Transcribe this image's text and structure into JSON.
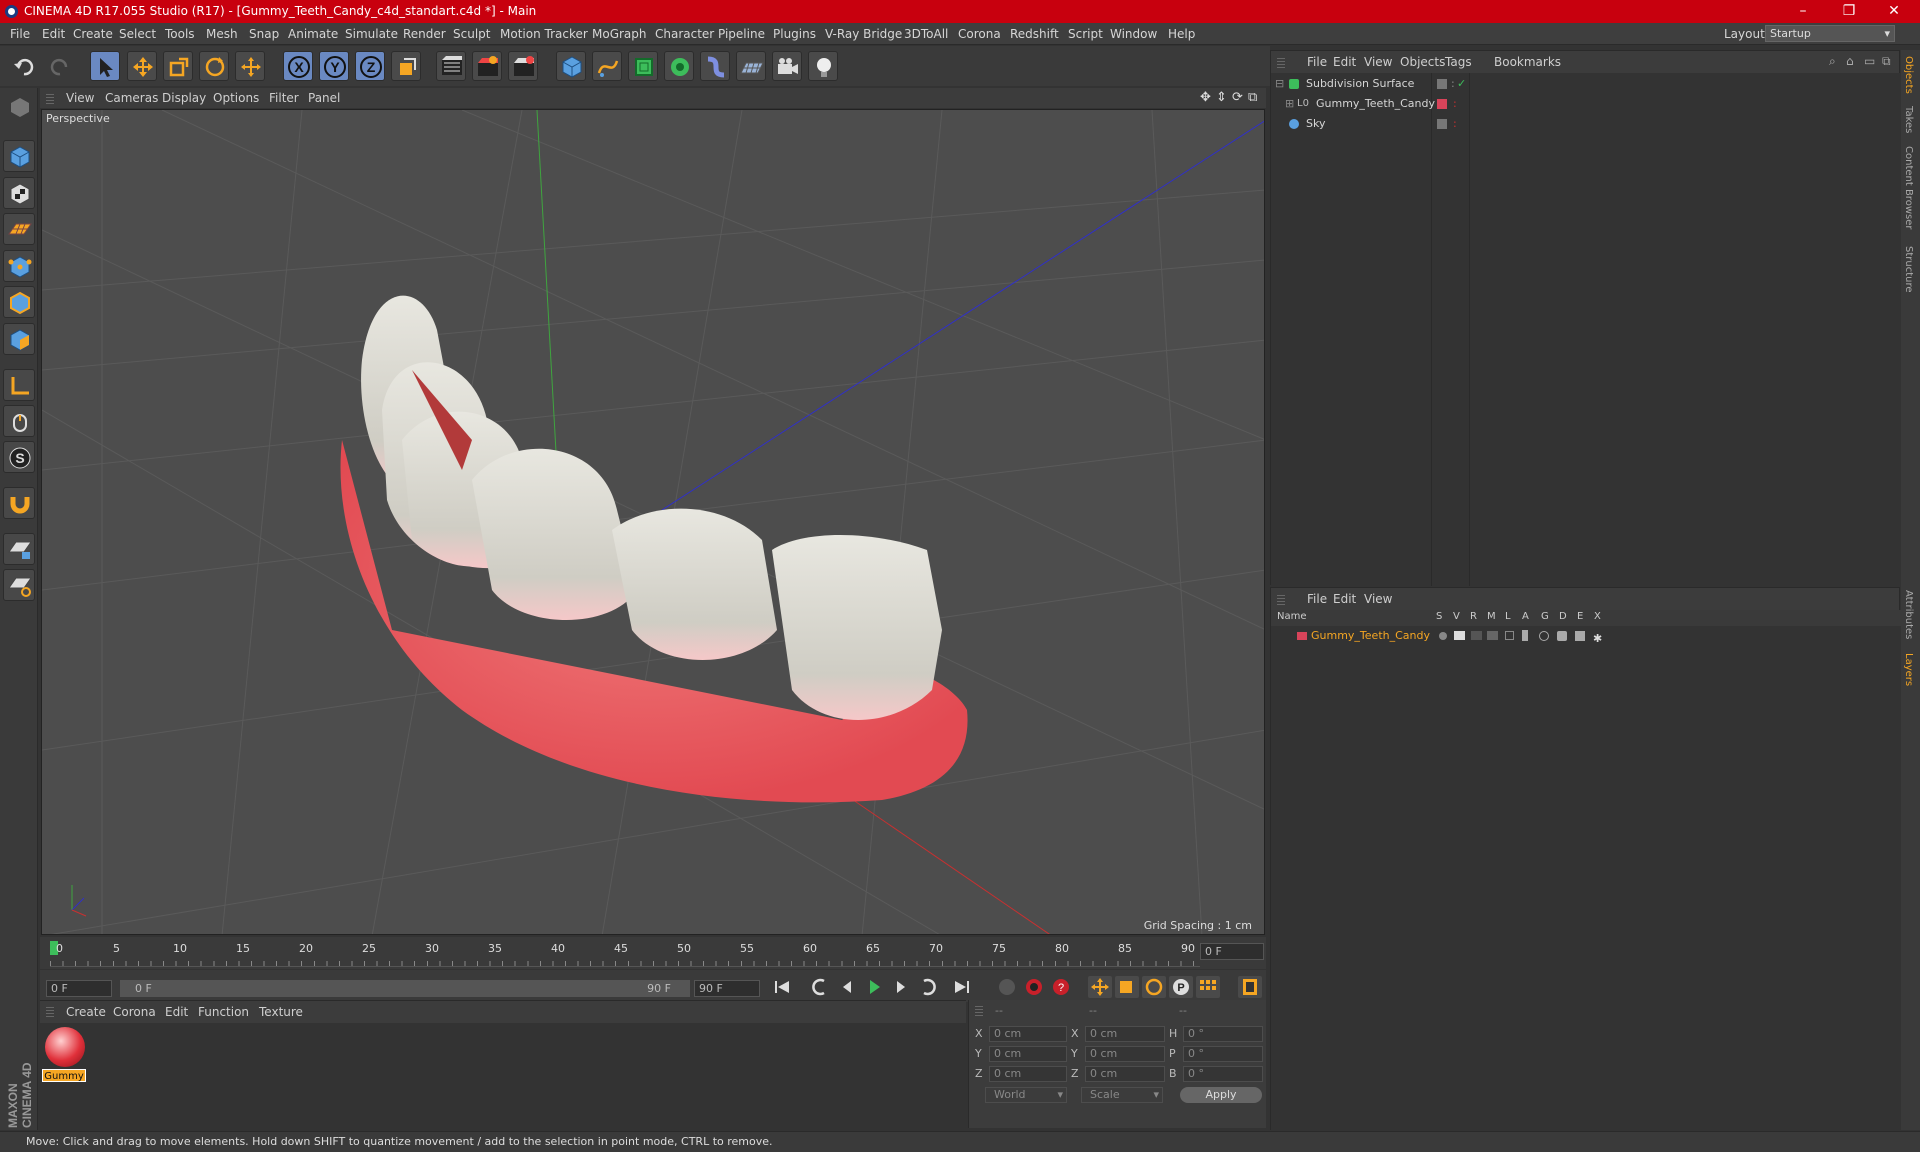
{
  "window": {
    "title": "CINEMA 4D R17.055 Studio (R17) - [Gummy_Teeth_Candy_c4d_standart.c4d *] - Main"
  },
  "menubar": {
    "items": [
      "File",
      "Edit",
      "Create",
      "Select",
      "Tools",
      "Mesh",
      "Snap",
      "Animate",
      "Simulate",
      "Render",
      "Sculpt",
      "Motion Tracker",
      "MoGraph",
      "Character",
      "Pipeline",
      "Plugins",
      "V-Ray Bridge",
      "3DToAll",
      "Corona",
      "Redshift",
      "Script",
      "Window",
      "Help"
    ],
    "layout_label": "Layout:",
    "layout_value": "Startup"
  },
  "toolbar": {
    "axis_x": "X",
    "axis_y": "Y",
    "axis_z": "Z"
  },
  "viewport": {
    "menu": [
      "View",
      "Cameras",
      "Display",
      "Options",
      "Filter",
      "Panel"
    ],
    "camera": "Perspective",
    "grid_spacing": "Grid Spacing : 1 cm"
  },
  "timeline": {
    "ticks": [
      "0",
      "5",
      "10",
      "15",
      "20",
      "25",
      "30",
      "35",
      "40",
      "45",
      "50",
      "55",
      "60",
      "65",
      "70",
      "75",
      "80",
      "85",
      "90"
    ],
    "current_frame": "0 F"
  },
  "playbar": {
    "start": "0 F",
    "range_start": "0 F",
    "range_end": "90 F",
    "end": "90 F"
  },
  "material_manager": {
    "menu": [
      "Create",
      "Corona",
      "Edit",
      "Function",
      "Texture"
    ],
    "materials": [
      {
        "name": "Gummy"
      }
    ]
  },
  "coordinates": {
    "header_a": "--",
    "header_b": "--",
    "header_c": "--",
    "pos": [
      {
        "axis": "X",
        "value": "0 cm"
      },
      {
        "axis": "Y",
        "value": "0 cm"
      },
      {
        "axis": "Z",
        "value": "0 cm"
      }
    ],
    "size": [
      {
        "axis": "X",
        "value": "0 cm"
      },
      {
        "axis": "Y",
        "value": "0 cm"
      },
      {
        "axis": "Z",
        "value": "0 cm"
      }
    ],
    "rot": [
      {
        "axis": "H",
        "value": "0 °"
      },
      {
        "axis": "P",
        "value": "0 °"
      },
      {
        "axis": "B",
        "value": "0 °"
      }
    ],
    "mode1": "World",
    "mode2": "Scale",
    "apply": "Apply"
  },
  "object_manager": {
    "menu": [
      "File",
      "Edit",
      "View",
      "Objects",
      "Tags",
      "Bookmarks"
    ],
    "objects": [
      {
        "name": "Subdivision Surface"
      },
      {
        "name": "Gummy_Teeth_Candy"
      },
      {
        "name": "Sky"
      }
    ]
  },
  "layer_manager": {
    "menu": [
      "File",
      "Edit",
      "View"
    ],
    "columns": [
      "Name",
      "S",
      "V",
      "R",
      "M",
      "L",
      "A",
      "G",
      "D",
      "E",
      "X"
    ],
    "layers": [
      {
        "name": "Gummy_Teeth_Candy",
        "color": "#d8445a"
      }
    ]
  },
  "right_tabs": [
    "Objects",
    "Takes",
    "Content Browser",
    "Structure",
    "Attributes",
    "Layers"
  ],
  "status": "Move: Click and drag to move elements. Hold down SHIFT to quantize movement / add to the selection in point mode, CTRL to remove.",
  "brand": "MAXON CINEMA 4D"
}
